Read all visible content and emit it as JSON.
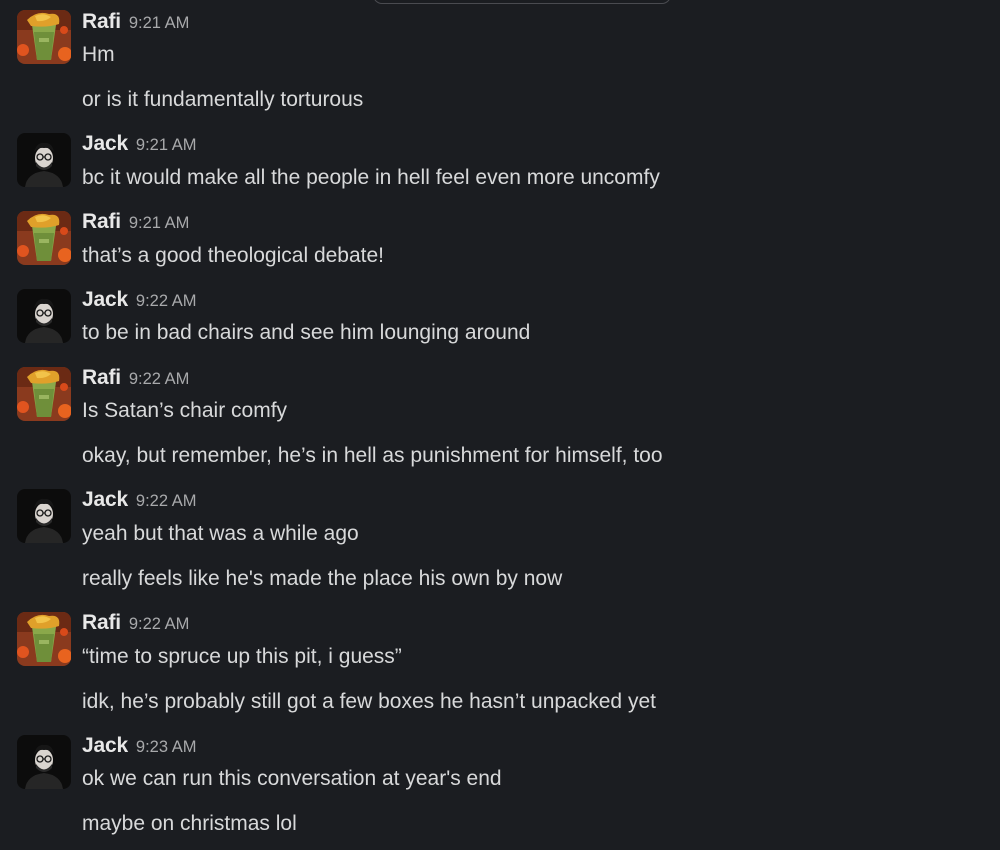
{
  "messages": [
    {
      "author": "Rafi",
      "avatar": "rafi-avatar",
      "time": "9:21 AM",
      "lines": [
        "Hm",
        "or is it fundamentally torturous"
      ]
    },
    {
      "author": "Jack",
      "avatar": "jack-avatar",
      "time": "9:21 AM",
      "lines": [
        "bc it would make all the people in hell feel even more uncomfy"
      ]
    },
    {
      "author": "Rafi",
      "avatar": "rafi-avatar",
      "time": "9:21 AM",
      "lines": [
        "that’s a good theological debate!"
      ]
    },
    {
      "author": "Jack",
      "avatar": "jack-avatar",
      "time": "9:22 AM",
      "lines": [
        "to be in bad chairs and see him lounging around"
      ]
    },
    {
      "author": "Rafi",
      "avatar": "rafi-avatar",
      "time": "9:22 AM",
      "lines": [
        "Is Satan’s chair comfy",
        "okay, but remember, he’s in hell as punishment for himself, too"
      ]
    },
    {
      "author": "Jack",
      "avatar": "jack-avatar",
      "time": "9:22 AM",
      "lines": [
        "yeah but that was a while ago",
        "really feels like he's made the place his own by now"
      ]
    },
    {
      "author": "Rafi",
      "avatar": "rafi-avatar",
      "time": "9:22 AM",
      "lines": [
        "“time to spruce up this pit, i guess”",
        "idk, he’s probably still got a few boxes he hasn’t unpacked yet"
      ]
    },
    {
      "author": "Jack",
      "avatar": "jack-avatar",
      "time": "9:23 AM",
      "lines": [
        "ok we can run this conversation at year's end",
        "maybe on christmas lol"
      ]
    }
  ],
  "colors": {
    "background": "#1b1d21",
    "name": "#e8e8e8",
    "time": "#a8a9ab",
    "text": "#d8d9da"
  }
}
